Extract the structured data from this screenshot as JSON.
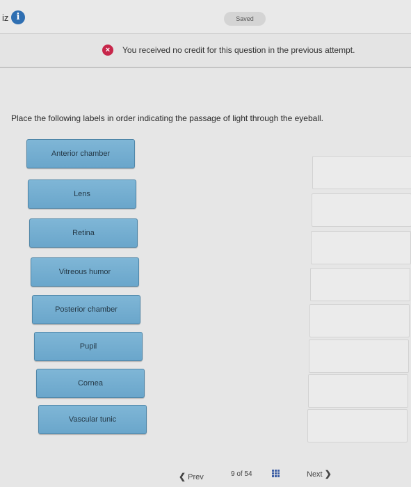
{
  "header": {
    "title_fragment": "iz",
    "info_icon": "info-icon",
    "info_glyph": "i",
    "saved_label": "Saved"
  },
  "notice": {
    "icon": "error-x-icon",
    "icon_glyph": "×",
    "text": "You received no credit for this question in the previous attempt.",
    "icon_color": "#c7264a"
  },
  "question": {
    "prompt": "Place the following labels in order indicating the passage of light through the eyeball."
  },
  "labels": [
    "Anterior chamber",
    "Lens",
    "Retina",
    "Vitreous humor",
    "Posterior chamber",
    "Pupil",
    "Cornea",
    "Vascular tunic"
  ],
  "footer": {
    "prev_label": "Prev",
    "prev_glyph": "❮",
    "current": "9",
    "of_label": "of",
    "total": "54",
    "grid_icon": "grid-icon",
    "next_label": "Next",
    "next_glyph": "❯"
  },
  "colors": {
    "tile": "#76afd2",
    "tile_border": "#4f86a8",
    "background": "#e6e6e6"
  }
}
